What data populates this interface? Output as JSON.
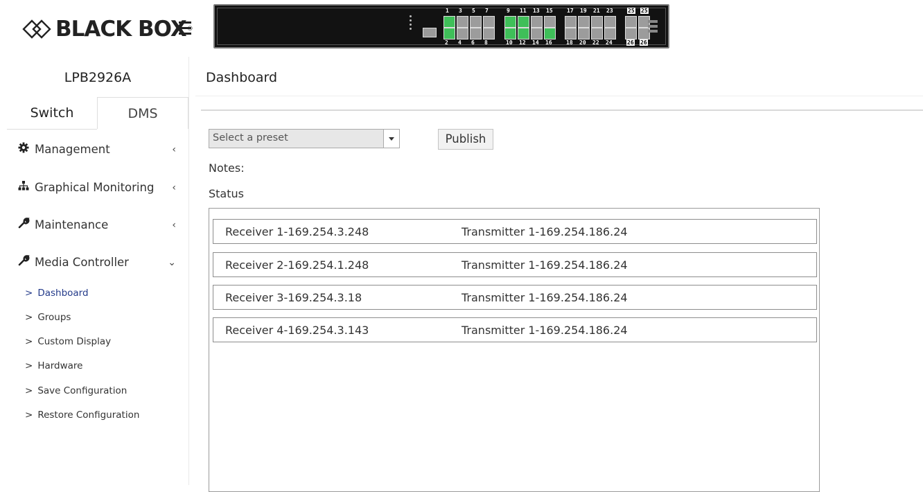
{
  "brand": {
    "logo_text": "BLACK BOX",
    "logo_mark": "®"
  },
  "device": {
    "name": "LPB2926A"
  },
  "ports": {
    "top": [
      "1",
      "3",
      "5",
      "7",
      "9",
      "11",
      "13",
      "15",
      "17",
      "19",
      "21",
      "23",
      "25",
      "25"
    ],
    "bottom": [
      "2",
      "4",
      "6",
      "8",
      "10",
      "12",
      "14",
      "16",
      "18",
      "20",
      "22",
      "24",
      "26",
      "26"
    ],
    "up_colors": {
      "up": "#3fbf59",
      "down": "#9c9c9c"
    }
  },
  "sidebar": {
    "tabs": [
      {
        "label": "Switch"
      },
      {
        "label": "DMS"
      }
    ],
    "menu": [
      {
        "label": "Management",
        "icon": "gear-icon",
        "chevron": "‹"
      },
      {
        "label": "Graphical Monitoring",
        "icon": "sitemap-icon",
        "chevron": "‹"
      },
      {
        "label": "Maintenance",
        "icon": "wrench-icon",
        "chevron": "‹"
      },
      {
        "label": "Media Controller",
        "icon": "wrench-icon",
        "chevron": "⌄"
      }
    ],
    "submenu": [
      {
        "label": "Dashboard",
        "marker": ">"
      },
      {
        "label": "Groups",
        "marker": ">"
      },
      {
        "label": "Custom Display",
        "marker": ">"
      },
      {
        "label": "Hardware",
        "marker": ">"
      },
      {
        "label": "Save Configuration",
        "marker": ">"
      },
      {
        "label": "Restore Configuration",
        "marker": ">"
      }
    ]
  },
  "main": {
    "title": "Dashboard",
    "preset": {
      "selected": "Select a preset"
    },
    "publish_label": "Publish",
    "notes_label": "Notes:",
    "status_label": "Status",
    "status_rows": [
      {
        "receiver": "Receiver 1-169.254.3.248",
        "transmitter": "Transmitter 1-169.254.186.24"
      },
      {
        "receiver": "Receiver 2-169.254.1.248",
        "transmitter": "Transmitter 1-169.254.186.24"
      },
      {
        "receiver": "Receiver 3-169.254.3.18",
        "transmitter": "Transmitter 1-169.254.186.24"
      },
      {
        "receiver": "Receiver 4-169.254.3.143",
        "transmitter": "Transmitter 1-169.254.186.24"
      }
    ]
  },
  "colors": {
    "active_link": "#243b8a"
  }
}
